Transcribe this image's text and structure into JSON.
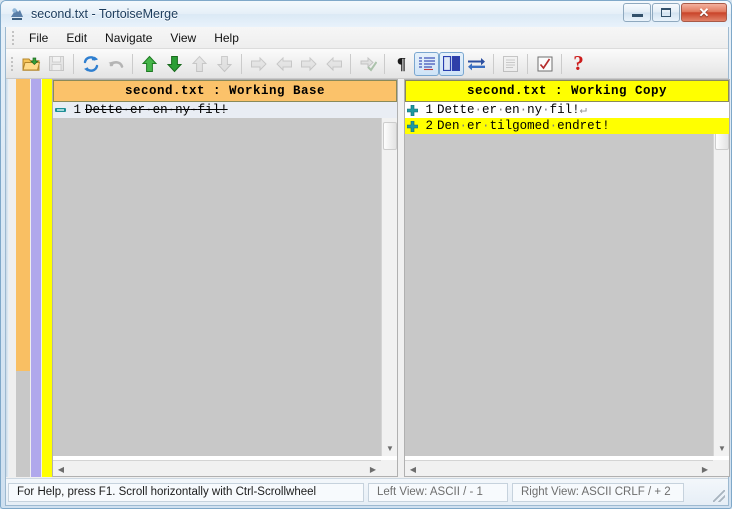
{
  "window": {
    "title": "second.txt - TortoiseMerge",
    "app_icon": "tortoisemerge-icon",
    "buttons": {
      "minimize": "minimize-button",
      "maximize": "maximize-button",
      "close_label": "✕"
    }
  },
  "menubar": {
    "items": [
      {
        "label": "File",
        "name": "menu-file"
      },
      {
        "label": "Edit",
        "name": "menu-edit"
      },
      {
        "label": "Navigate",
        "name": "menu-navigate"
      },
      {
        "label": "View",
        "name": "menu-view"
      },
      {
        "label": "Help",
        "name": "menu-help"
      }
    ]
  },
  "toolbar": {
    "items": [
      {
        "name": "open-icon",
        "enabled": true,
        "active": false
      },
      {
        "name": "save-icon",
        "enabled": false,
        "active": false
      },
      {
        "sep": true
      },
      {
        "name": "reload-icon",
        "enabled": true,
        "active": false
      },
      {
        "name": "undo-icon",
        "enabled": false,
        "active": false
      },
      {
        "sep": true
      },
      {
        "name": "prev-difference-icon",
        "enabled": true,
        "active": false
      },
      {
        "name": "next-difference-icon",
        "enabled": true,
        "active": false
      },
      {
        "name": "prev-conflict-icon",
        "enabled": false,
        "active": false
      },
      {
        "name": "next-conflict-icon",
        "enabled": false,
        "active": false
      },
      {
        "sep": true
      },
      {
        "name": "use-left-block-icon",
        "enabled": false,
        "active": false
      },
      {
        "name": "use-right-block-icon",
        "enabled": false,
        "active": false
      },
      {
        "name": "use-left-then-right-icon",
        "enabled": false,
        "active": false
      },
      {
        "name": "use-right-then-left-icon",
        "enabled": false,
        "active": false
      },
      {
        "sep": true
      },
      {
        "name": "mark-as-resolved-icon",
        "enabled": false,
        "active": false
      },
      {
        "sep": true
      },
      {
        "name": "show-whitespace-icon",
        "enabled": true,
        "active": false,
        "glyph": "¶"
      },
      {
        "name": "show-line-numbers-icon",
        "enabled": true,
        "active": true
      },
      {
        "name": "two-pane-view-icon",
        "enabled": true,
        "active": true
      },
      {
        "name": "switch-views-icon",
        "enabled": true,
        "active": false
      },
      {
        "sep": true
      },
      {
        "name": "one-pane-view-icon",
        "enabled": false,
        "active": false
      },
      {
        "sep": true
      },
      {
        "name": "apply-patch-icon",
        "enabled": true,
        "active": false
      },
      {
        "sep": true
      },
      {
        "name": "help-icon",
        "enabled": true,
        "active": false,
        "glyph": "?"
      }
    ]
  },
  "locator": {
    "columns": [
      {
        "name": "locator-left-removed",
        "color": "#f9bf63"
      },
      {
        "name": "locator-middle",
        "color": "#b0a8ec"
      },
      {
        "name": "locator-right-added",
        "color": "#ffff00"
      }
    ]
  },
  "left_pane": {
    "header": "second.txt : Working Base",
    "header_color": "#fbc26a",
    "lines": [
      {
        "marker": "removed-marker",
        "number": "1",
        "segments": [
          {
            "t": "Dette",
            "kind": "text"
          },
          {
            "t": "·",
            "kind": "ws"
          },
          {
            "t": "er",
            "kind": "text"
          },
          {
            "t": "·",
            "kind": "ws"
          },
          {
            "t": "en",
            "kind": "text"
          },
          {
            "t": "·",
            "kind": "ws"
          },
          {
            "t": "ny",
            "kind": "text"
          },
          {
            "t": "·",
            "kind": "ws"
          },
          {
            "t": "fil!",
            "kind": "text"
          }
        ],
        "style": "removed",
        "strike": true,
        "eol": ""
      }
    ]
  },
  "right_pane": {
    "header": "second.txt : Working Copy",
    "header_color": "#ffff00",
    "lines": [
      {
        "marker": "added-marker",
        "number": "1",
        "segments": [
          {
            "t": "Dette",
            "kind": "text"
          },
          {
            "t": "·",
            "kind": "ws"
          },
          {
            "t": "er",
            "kind": "text"
          },
          {
            "t": "·",
            "kind": "ws"
          },
          {
            "t": "en",
            "kind": "text"
          },
          {
            "t": "·",
            "kind": "ws"
          },
          {
            "t": "ny",
            "kind": "text"
          },
          {
            "t": "·",
            "kind": "ws"
          },
          {
            "t": "fil!",
            "kind": "text"
          }
        ],
        "style": "plain",
        "strike": false,
        "eol": "↵"
      },
      {
        "marker": "added-marker",
        "number": "2",
        "segments": [
          {
            "t": "Den",
            "kind": "text"
          },
          {
            "t": "·",
            "kind": "ws"
          },
          {
            "t": "er",
            "kind": "text"
          },
          {
            "t": "·",
            "kind": "ws"
          },
          {
            "t": "tilgomed",
            "kind": "text"
          },
          {
            "t": "·",
            "kind": "ws"
          },
          {
            "t": "endret!",
            "kind": "text"
          }
        ],
        "style": "added",
        "strike": false,
        "eol": ""
      }
    ]
  },
  "statusbar": {
    "hint": "For Help, press F1. Scroll horizontally with Ctrl-Scrollwheel",
    "left_view": "Left View: ASCII  / - 1",
    "right_view": "Right View: ASCII CRLF  / + 2"
  }
}
